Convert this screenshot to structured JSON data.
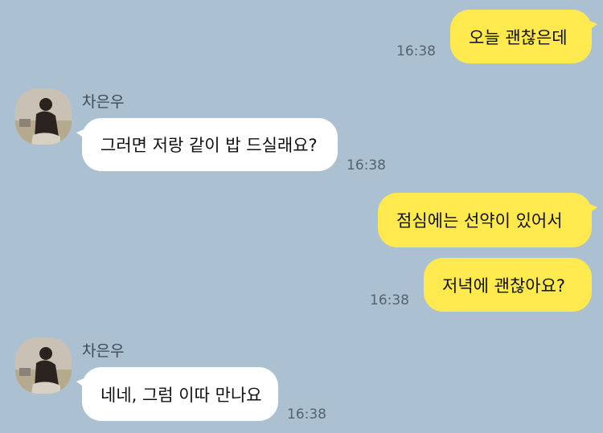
{
  "messages": [
    {
      "sender": "me",
      "text": "오늘 괜찮은데",
      "time": "16:38"
    },
    {
      "sender": "차은우",
      "text": "그러면 저랑 같이 밥 드실래요?",
      "time": "16:38"
    },
    {
      "sender": "me",
      "text": "점심에는 선약이 있어서"
    },
    {
      "sender": "me",
      "text": "저녁에 괜찮아요?",
      "time": "16:38"
    },
    {
      "sender": "차은우",
      "text": "네네, 그럼 이따 만나요",
      "time": "16:38"
    }
  ],
  "contact": {
    "name": "차은우",
    "avatar_icon": "person-photo-icon"
  },
  "colors": {
    "background": "#abc1d1",
    "my_bubble": "#fee94e",
    "their_bubble": "#ffffff"
  }
}
